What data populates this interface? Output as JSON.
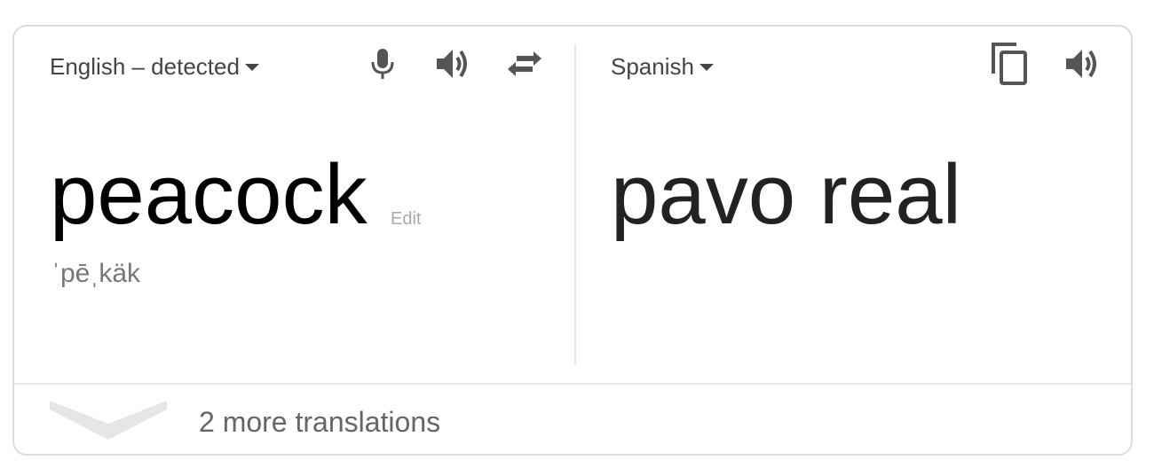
{
  "source": {
    "language_label": "English – detected",
    "text": "peacock",
    "edit_label": "Edit",
    "pronunciation": "ˈpēˌkäk",
    "icons": [
      "microphone-icon",
      "speaker-icon",
      "swap-icon"
    ]
  },
  "target": {
    "language_label": "Spanish",
    "text": "pavo real",
    "icons": [
      "copy-icon",
      "speaker-icon"
    ]
  },
  "footer": {
    "more_translations_label": "2 more translations",
    "icon": "chevron-down-icon"
  },
  "colors": {
    "icon": "#555555",
    "border": "#dadce0",
    "divider": "#e8e8e8",
    "muted_text": "#aaaaaa"
  }
}
